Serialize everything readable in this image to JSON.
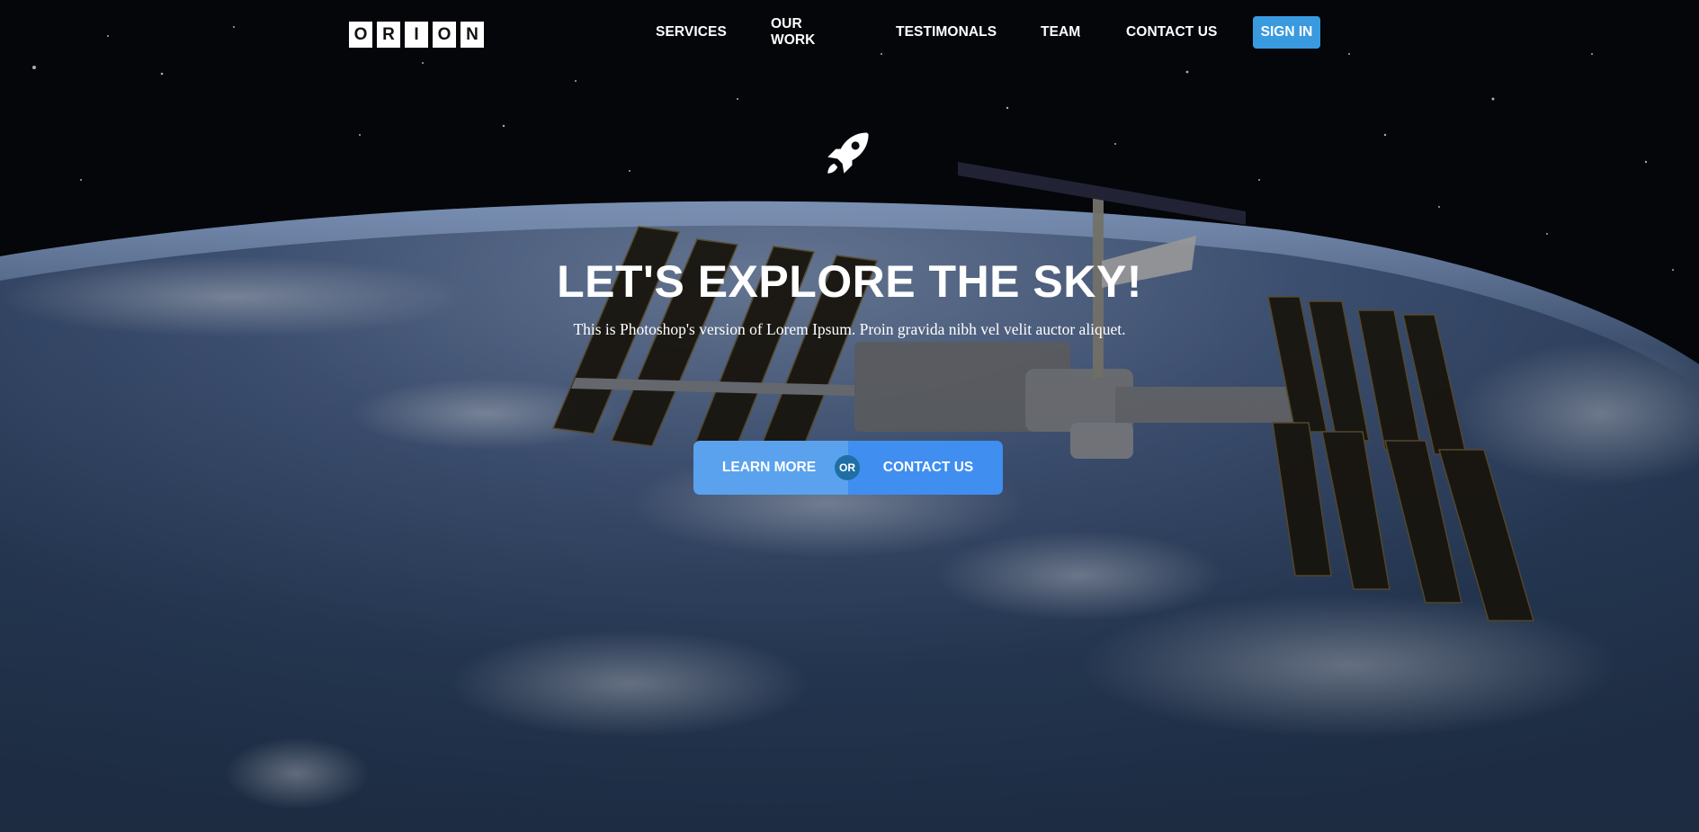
{
  "brand": {
    "letters": [
      "O",
      "R",
      "I",
      "O",
      "N"
    ]
  },
  "nav": {
    "items": [
      {
        "label": "SERVICES"
      },
      {
        "label": "OUR WORK"
      },
      {
        "label": "TESTIMONALS"
      },
      {
        "label": "TEAM"
      },
      {
        "label": "CONTACT US"
      }
    ],
    "signin_label": "SIGN IN"
  },
  "hero": {
    "icon": "rocket-icon",
    "title": "LET'S EXPLORE THE SKY!",
    "subtitle": "This is Photoshop's version of Lorem Ipsum. Proin gravida nibh vel velit auctor aliquet.",
    "cta": {
      "primary_label": "LEARN MORE",
      "separator": "OR",
      "secondary_label": "CONTACT US"
    }
  },
  "colors": {
    "accent": "#3a9ae0",
    "cta_left": "#5aa2ee",
    "cta_right": "#3f8ef0",
    "or_badge": "#1f6fa5"
  }
}
